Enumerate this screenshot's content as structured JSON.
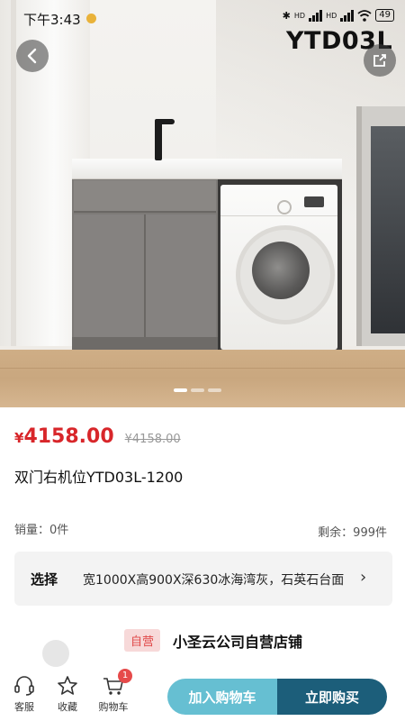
{
  "status_bar": {
    "time": "下午3:43",
    "bt": "✱",
    "sig1": "HD",
    "sig2": "HD",
    "battery": "49"
  },
  "hero": {
    "model_tag": "YTD03L",
    "slide_count": 3,
    "active_slide": 0
  },
  "product": {
    "currency": "¥",
    "price": "4158.00",
    "original_price": "¥4158.00",
    "title": "双门右机位YTD03L-1200",
    "sales": "销量：0件",
    "remaining": "剩余：999件"
  },
  "spec_select": {
    "label": "选择",
    "value": "宽1000X高900X深630冰海湾灰，石英石台面",
    "chevron": "›"
  },
  "shop": {
    "badge": "自营",
    "name": "小圣云公司自营店铺"
  },
  "bottom_nav": {
    "customer_service": "客服",
    "favorite": "收藏",
    "cart": "购物车",
    "cart_count": "1"
  },
  "actions": {
    "add_to_cart": "加入购物车",
    "buy_now": "立即购买"
  },
  "colors": {
    "price_red": "#d8262a",
    "add_btn": "#66bfd2",
    "buy_btn": "#1c5e7a"
  }
}
